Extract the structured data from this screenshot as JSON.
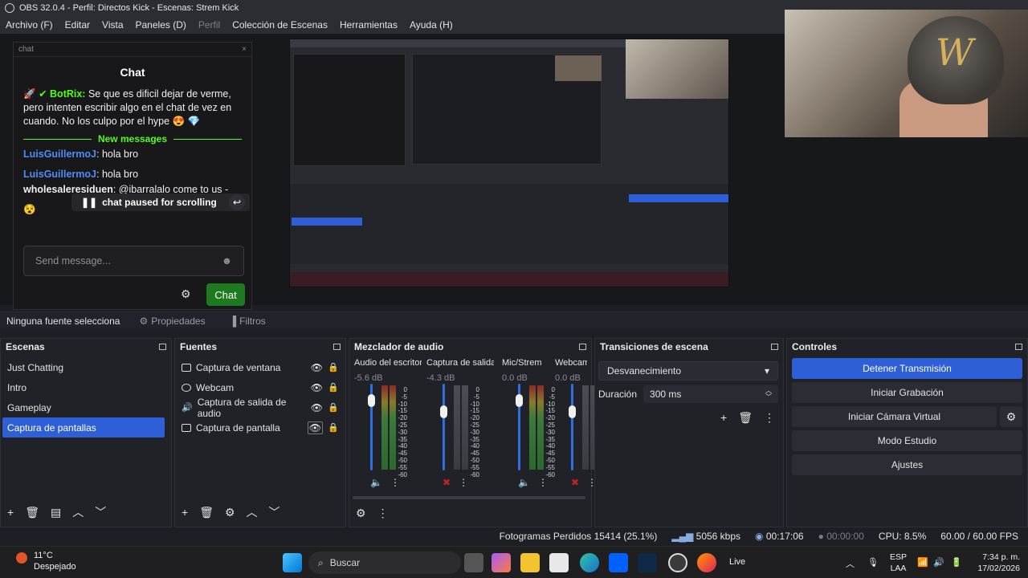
{
  "window": {
    "title": "OBS 32.0.4 - Perfil: Directos Kick - Escenas: Strem Kick"
  },
  "menu": {
    "items": [
      "Archivo (F)",
      "Editar",
      "Vista",
      "Paneles (D)",
      "Perfil",
      "Colección de Escenas",
      "Herramientas",
      "Ayuda (H)"
    ]
  },
  "chat": {
    "tab_label": "chat",
    "close": "×",
    "title": "Chat",
    "bot_name": "BotRix:",
    "bot_message": "Se que es dificil dejar de verme, pero intenten escribir algo en el chat de vez en cuando. No los culpo por el hype 😍 💎",
    "new_messages": "New messages",
    "msg1_user": "LuisGuillermoJ",
    "msg1_text": ": hola bro",
    "msg2_user": "LuisGuillermoJ",
    "msg2_text": ": hola bro",
    "msg3_user": "wholesaleresiduen",
    "msg3_text": ": @ibarralalo come to us -",
    "paused": "chat paused for scrolling",
    "send_placeholder": "Send message...",
    "chat_button": "Chat"
  },
  "properties_bar": {
    "no_source": "Ninguna fuente selecciona",
    "properties": "Propiedades",
    "filters": "Filtros"
  },
  "scenes": {
    "title": "Escenas",
    "items": [
      "Just Chatting",
      "Intro",
      "Gameplay",
      "Captura de pantallas"
    ],
    "selected_index": 3
  },
  "sources": {
    "title": "Fuentes",
    "items": [
      "Captura de ventana",
      "Webcam",
      "Captura de salida de audio",
      "Captura de pantalla"
    ]
  },
  "mixer": {
    "title": "Mezclador de audio",
    "channels": [
      {
        "name": "Audio del escritorio",
        "db": "-5.6 dB",
        "level": 0.72,
        "muted": false
      },
      {
        "name": "Captura de salida d",
        "db": "-4.3 dB",
        "level": 0.0,
        "muted": true
      },
      {
        "name": "Mic/Strem",
        "db": "0.0 dB",
        "level": 0.82,
        "muted": false
      },
      {
        "name": "Webcam",
        "db": "0.0 dB",
        "level": 0.0,
        "muted": true
      }
    ],
    "scale": [
      "0",
      "-5",
      "-10",
      "-15",
      "-20",
      "-25",
      "-30",
      "-35",
      "-40",
      "-45",
      "-50",
      "-55",
      "-60"
    ]
  },
  "transitions": {
    "title": "Transiciones de escena",
    "selected": "Desvanecimiento",
    "duration_label": "Duración",
    "duration_value": "300 ms"
  },
  "controls": {
    "title": "Controles",
    "buttons": [
      "Detener Transmisión",
      "Iniciar Grabación",
      "Iniciar Cámara Virtual",
      "Modo Estudio",
      "Ajustes"
    ]
  },
  "status": {
    "dropped": "Fotogramas Perdidos 15414 (25.1%)",
    "bitrate": "5056 kbps",
    "live_time": "00:17:06",
    "rec_time": "00:00:00",
    "cpu": "CPU: 8.5%",
    "fps": "60.00 / 60.00 FPS"
  },
  "taskbar": {
    "weather_temp": "11°C",
    "weather_desc": "Despejado",
    "search": "Buscar",
    "live_label": "Live",
    "lang1": "ESP",
    "lang2": "LAA",
    "time": "7:34 p. m.",
    "date": "17/02/2026"
  },
  "colors": {
    "accent": "#2f5fd6",
    "kick_green": "#53fc18",
    "mute_red": "#c4202a"
  }
}
